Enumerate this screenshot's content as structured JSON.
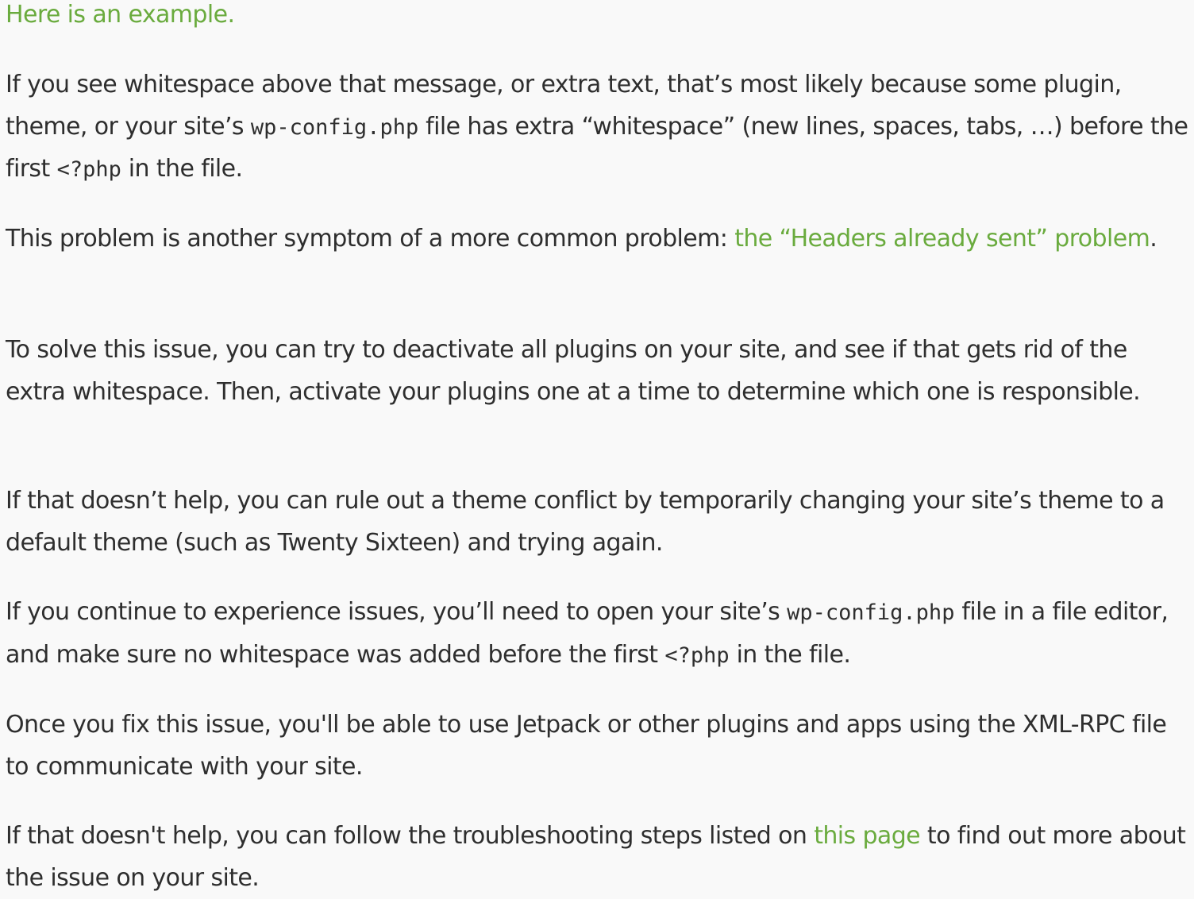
{
  "colors": {
    "background": "#f9f9f9",
    "text": "#2e2e2e",
    "link": "#6aab3e"
  },
  "example_link": "Here is an example.",
  "whitespace": {
    "text1": "If you see whitespace above that message, or extra text, that’s most likely because some plugin, theme, or your site’s ",
    "code1": "wp-config.php",
    "text2": " file has extra “whitespace” (new lines, spaces, tabs, …) before the first ",
    "code2": "<?php",
    "text3": " in the file."
  },
  "headers": {
    "text1": "This problem is another symptom of a more common problem: ",
    "link": "the “Headers already sent” problem",
    "text2": "."
  },
  "solve": {
    "text": "To solve this issue, you can try to deactivate all plugins on your site, and see if that gets rid of the extra whitespace. Then, activate your plugins one at a time to determine which one is responsible."
  },
  "theme": {
    "text": "If that doesn’t help, you can rule out a theme conflict by temporarily changing your site’s theme to a default theme (such as Twenty Sixteen) and trying again."
  },
  "config": {
    "text1": "If you continue to experience issues, you’ll need to open your site’s ",
    "code1": "wp-config.php",
    "text2": " file in a file editor, and make sure no whitespace was added before the first ",
    "code2": "<?php",
    "text3": " in the file."
  },
  "fix": {
    "text": "Once you fix this issue, you'll be able to use Jetpack or other plugins and apps using the XML-RPC file to communicate with your site."
  },
  "help": {
    "text1": "If that doesn't help, you can follow the troubleshooting steps listed on ",
    "link": "this page",
    "text2": " to find out more about the issue on your site."
  }
}
